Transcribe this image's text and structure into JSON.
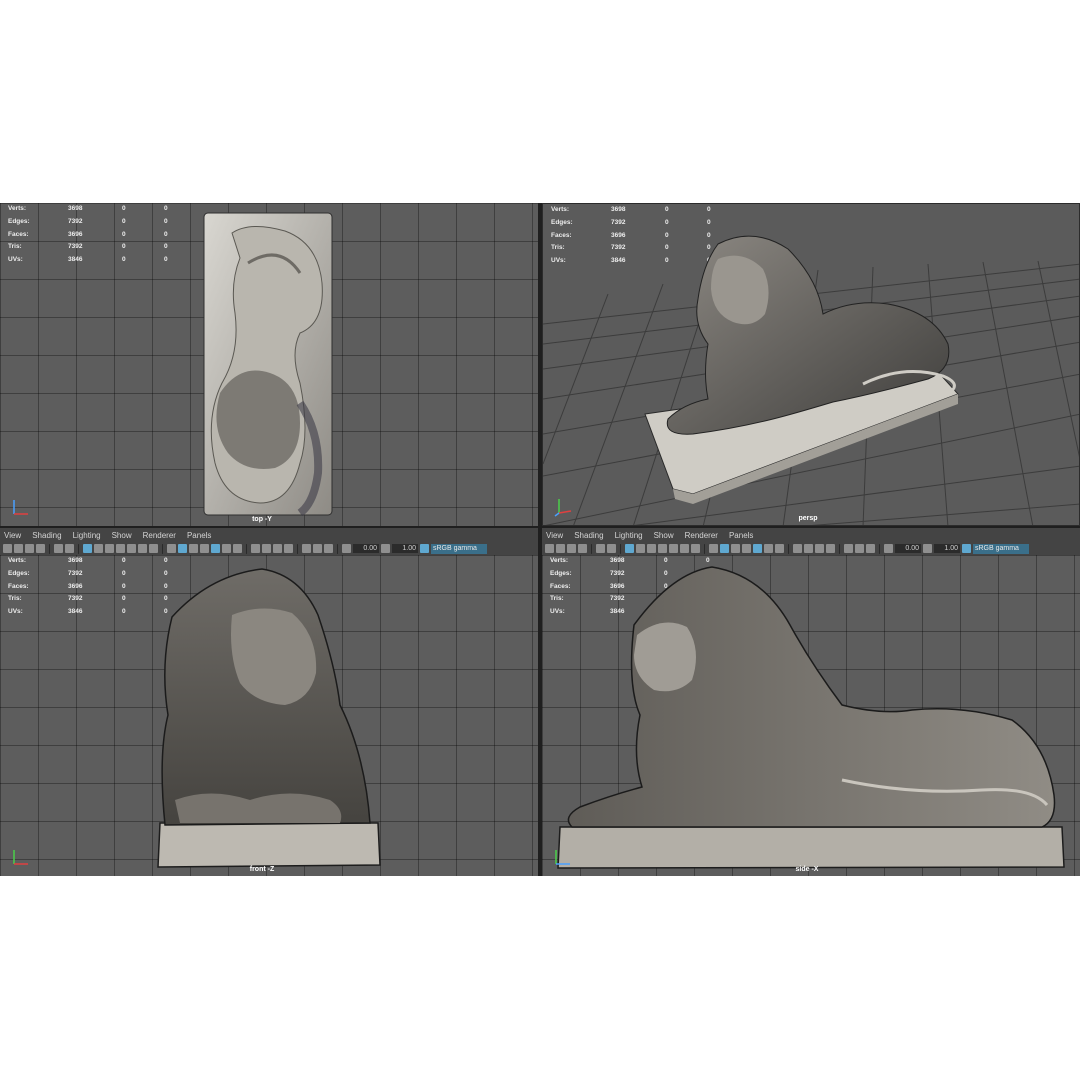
{
  "hud": {
    "rows": [
      {
        "label": "Verts:",
        "v1": "3698",
        "v2": "0",
        "v3": "0"
      },
      {
        "label": "Edges:",
        "v1": "7392",
        "v2": "0",
        "v3": "0"
      },
      {
        "label": "Faces:",
        "v1": "3696",
        "v2": "0",
        "v3": "0"
      },
      {
        "label": "Tris:",
        "v1": "7392",
        "v2": "0",
        "v3": "0"
      },
      {
        "label": "UVs:",
        "v1": "3846",
        "v2": "0",
        "v3": "0"
      }
    ]
  },
  "viewports": {
    "top": {
      "camera": "top -Y"
    },
    "persp": {
      "camera": "persp"
    },
    "front": {
      "camera": "front -Z"
    },
    "side": {
      "camera": "side -X"
    }
  },
  "panel_menu": {
    "items": [
      "View",
      "Shading",
      "Lighting",
      "Show",
      "Renderer",
      "Panels"
    ]
  },
  "toolbar": {
    "exposure_value": "0.00",
    "gamma_value": "1.00",
    "color_space_label": "sRGB gamma"
  },
  "colors": {
    "viewport_bg": "#5d5d5d",
    "grid_line": "#3f3f3f",
    "panel_bg": "#444444",
    "highlight": "#5fa8d0",
    "statue_stone": "#a9a59d"
  }
}
